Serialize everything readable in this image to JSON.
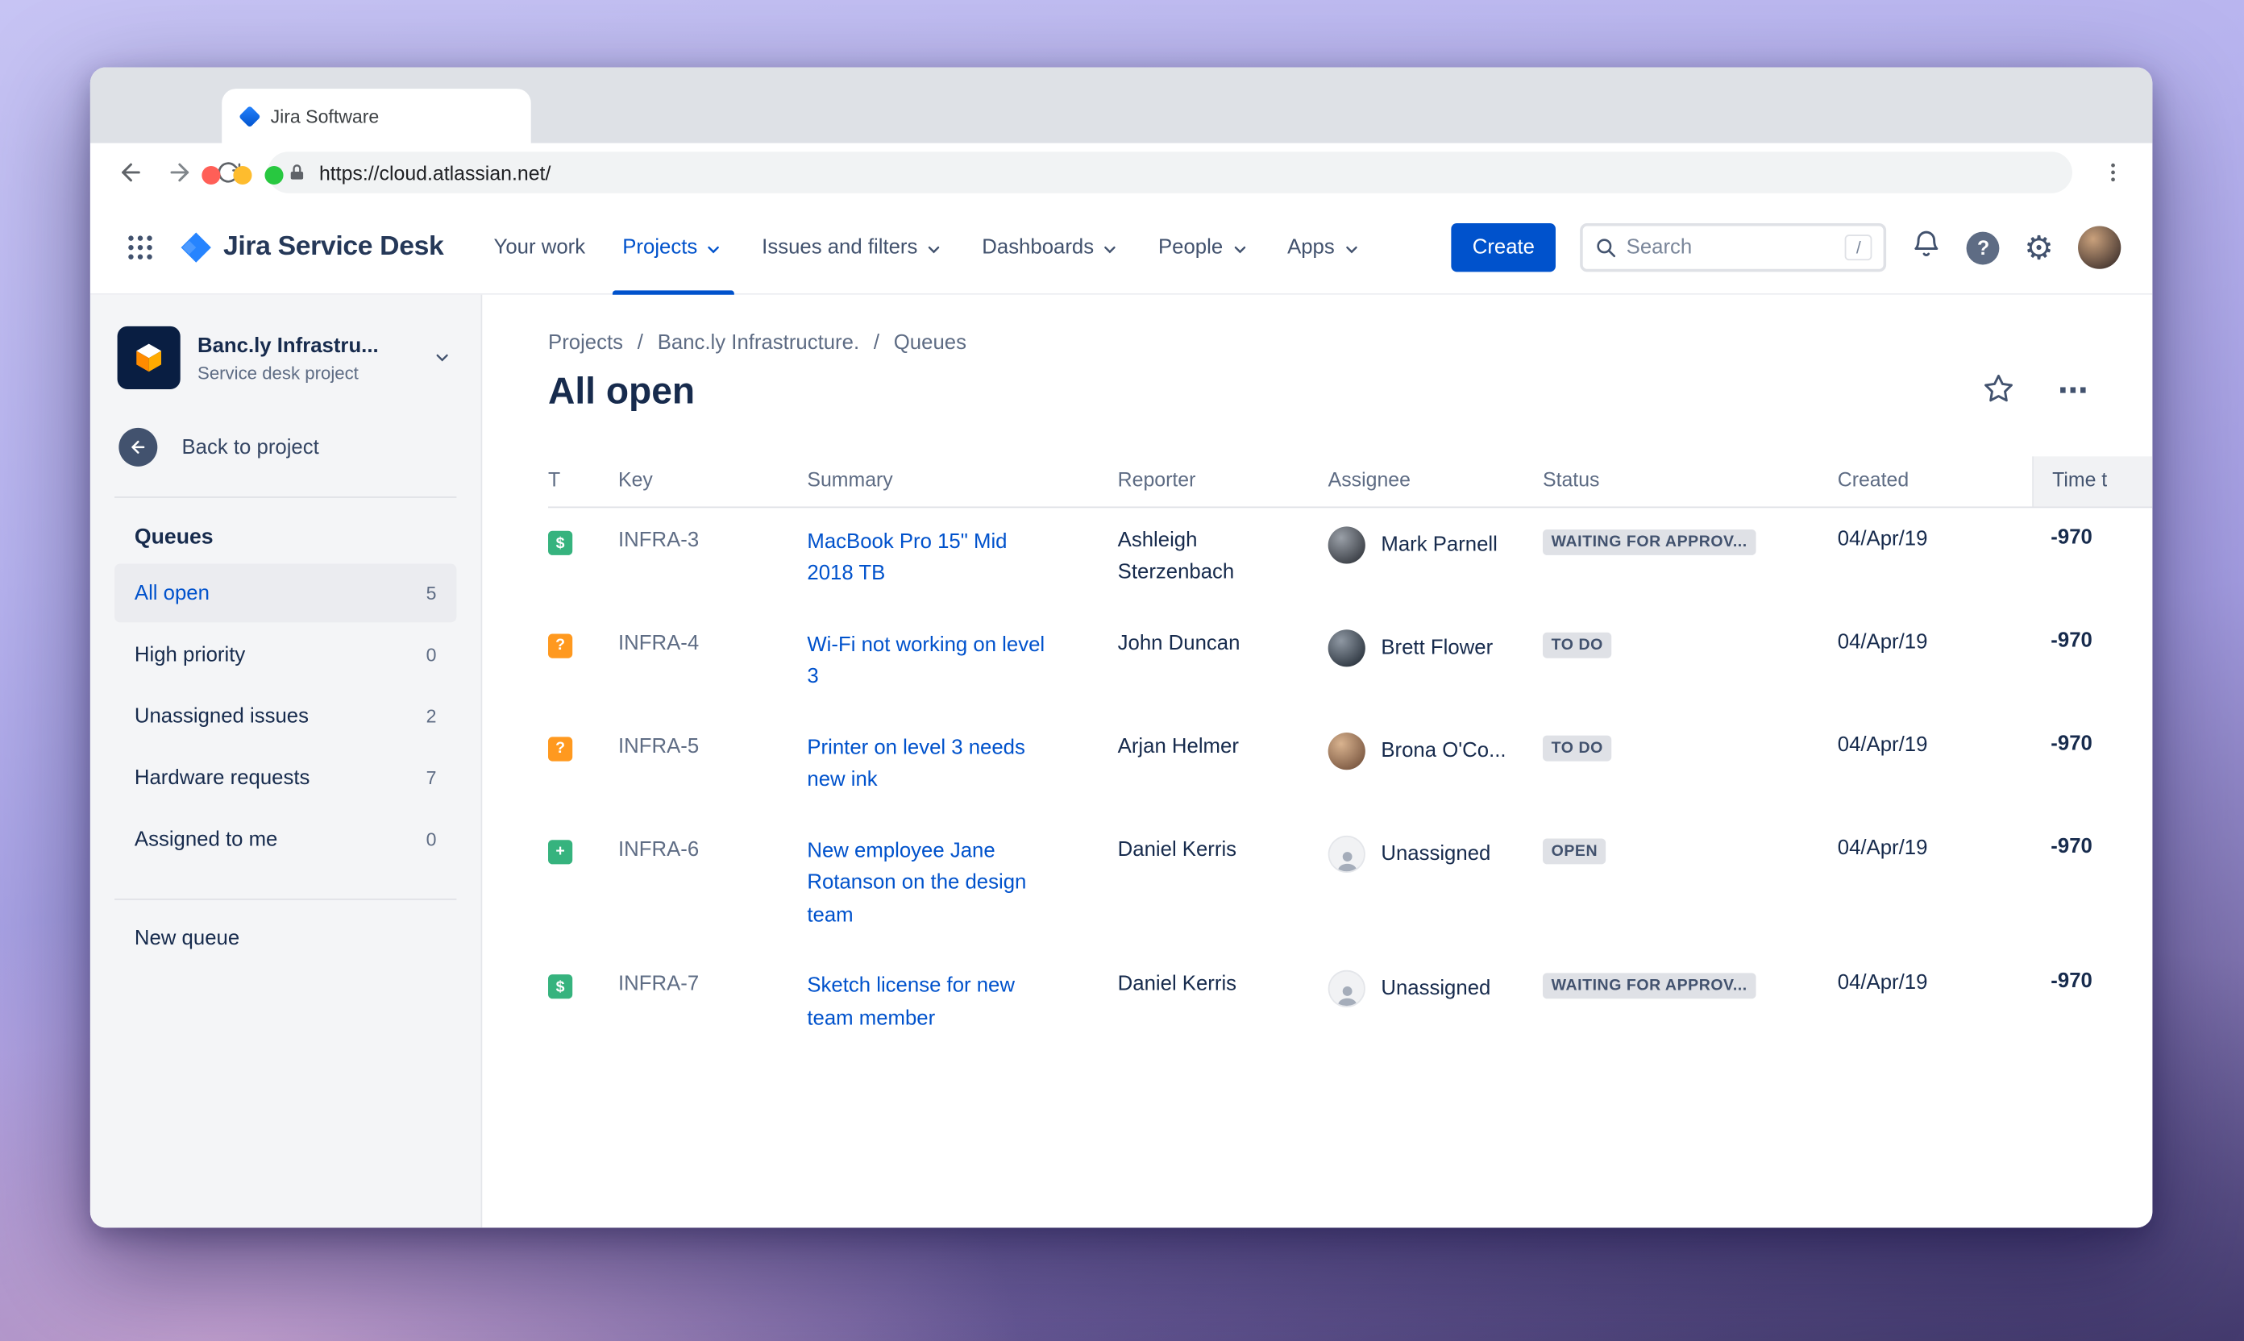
{
  "browser": {
    "tab_title": "Jira Software",
    "url": "https://cloud.atlassian.net/"
  },
  "app": {
    "product_name": "Jira Service Desk",
    "nav_items": [
      {
        "label": "Your work",
        "chevron": false,
        "active": false
      },
      {
        "label": "Projects",
        "chevron": true,
        "active": true
      },
      {
        "label": "Issues and filters",
        "chevron": true,
        "active": false
      },
      {
        "label": "Dashboards",
        "chevron": true,
        "active": false
      },
      {
        "label": "People",
        "chevron": true,
        "active": false
      },
      {
        "label": "Apps",
        "chevron": true,
        "active": false
      }
    ],
    "create_button": "Create",
    "search": {
      "placeholder": "Search",
      "shortcut": "/"
    }
  },
  "sidebar": {
    "project": {
      "name": "Banc.ly Infrastru...",
      "type": "Service desk project"
    },
    "back_to_project": "Back to project",
    "queues_heading": "Queues",
    "queues": [
      {
        "label": "All open",
        "count": "5",
        "selected": true
      },
      {
        "label": "High priority",
        "count": "0",
        "selected": false
      },
      {
        "label": "Unassigned issues",
        "count": "2",
        "selected": false
      },
      {
        "label": "Hardware requests",
        "count": "7",
        "selected": false
      },
      {
        "label": "Assigned to me",
        "count": "0",
        "selected": false
      }
    ],
    "new_queue": "New queue"
  },
  "main": {
    "breadcrumb": [
      "Projects",
      "Banc.ly Infrastructure.",
      "Queues"
    ],
    "title": "All open",
    "table": {
      "columns": [
        "T",
        "Key",
        "Summary",
        "Reporter",
        "Assignee",
        "Status",
        "Created",
        "Time t"
      ],
      "rows": [
        {
          "type_glyph": "$",
          "type_color": "#36B37E",
          "key": "INFRA-3",
          "summary": "MacBook Pro 15\" Mid 2018 TB",
          "reporter": "Ashleigh Sterzenbach",
          "assignee": "Mark Parnell",
          "avatar": {
            "kind": "photo",
            "color": "#3b3f46",
            "color2": "#9aa0a8"
          },
          "status": "WAITING FOR APPROV...",
          "created": "04/Apr/19",
          "time": "-970"
        },
        {
          "type_glyph": "?",
          "type_color": "#FF991F",
          "key": "INFRA-4",
          "summary": "Wi-Fi not working on level 3",
          "reporter": "John Duncan",
          "assignee": "Brett Flower",
          "avatar": {
            "kind": "photo",
            "color": "#2f3842",
            "color2": "#8f98a3"
          },
          "status": "TO DO",
          "created": "04/Apr/19",
          "time": "-970"
        },
        {
          "type_glyph": "?",
          "type_color": "#FF991F",
          "key": "INFRA-5",
          "summary": "Printer on level 3 needs new ink",
          "reporter": "Arjan Helmer",
          "assignee": "Brona O'Co...",
          "avatar": {
            "kind": "photo",
            "color": "#7d5a43",
            "color2": "#d9b38f"
          },
          "status": "TO DO",
          "created": "04/Apr/19",
          "time": "-970"
        },
        {
          "type_glyph": "+",
          "type_color": "#36B37E",
          "key": "INFRA-6",
          "summary": "New employee Jane Rotanson on the design team",
          "reporter": "Daniel Kerris",
          "assignee": "Unassigned",
          "avatar": {
            "kind": "unassigned"
          },
          "status": "OPEN",
          "created": "04/Apr/19",
          "time": "-970"
        },
        {
          "type_glyph": "$",
          "type_color": "#36B37E",
          "key": "INFRA-7",
          "summary": "Sketch license for new team member",
          "reporter": "Daniel Kerris",
          "assignee": "Unassigned",
          "avatar": {
            "kind": "unassigned"
          },
          "status": "WAITING FOR APPROV...",
          "created": "04/Apr/19",
          "time": "-970"
        }
      ]
    }
  },
  "colors": {
    "brand_blue": "#0052CC",
    "link_blue": "#0052CC",
    "text_dark": "#172B4D",
    "lozenge_bg": "#DFE1E6",
    "type_green": "#36B37E",
    "type_orange": "#FF991F"
  }
}
